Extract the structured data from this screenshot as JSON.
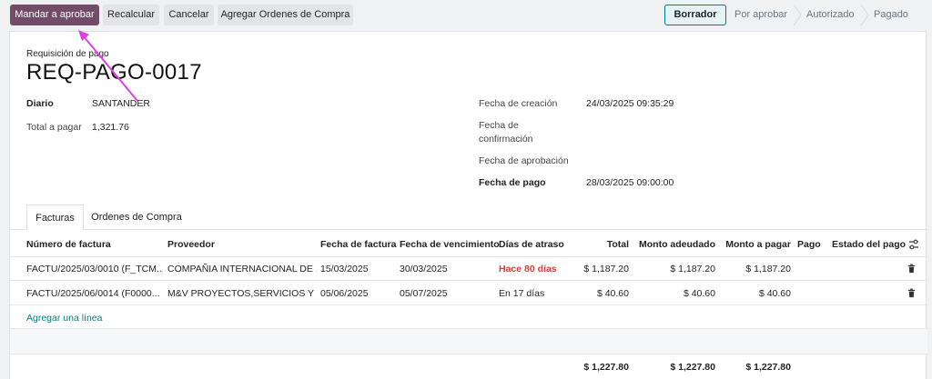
{
  "toolbar": {
    "send_label": "Mandar a aprobar",
    "recalc_label": "Recalcular",
    "cancel_label": "Cancelar",
    "add_po_label": "Agregar Ordenes de Compra"
  },
  "status": {
    "stages": [
      "Borrador",
      "Por aprobar",
      "Autorizado",
      "Pagado"
    ],
    "active": "Borrador"
  },
  "form": {
    "subtitle": "Requisición de pago",
    "title": "REQ-PAGO-0017",
    "diario_label": "Diario",
    "diario_value": "SANTANDER",
    "total_label": "Total a pagar",
    "total_value": "1,321.76",
    "creation_label": "Fecha de creación",
    "creation_value": "24/03/2025 09:35:29",
    "confirm_label_1": "Fecha de",
    "confirm_label_2": "confirmación",
    "approval_label": "Fecha de aprobación",
    "payment_label": "Fecha de pago",
    "payment_value": "28/03/2025 09:00:00"
  },
  "tabs": [
    "Facturas",
    "Ordenes de Compra"
  ],
  "table": {
    "headers": {
      "invoice": "Número de factura",
      "vendor": "Proveedor",
      "invoice_date": "Fecha de factura",
      "due_date": "Fecha de vencimiento",
      "overdue": "Días de atraso",
      "total": "Total",
      "due_amount": "Monto adeudado",
      "pay_amount": "Monto a pagar",
      "pago": "Pago",
      "pay_state": "Estado del pago"
    },
    "rows": [
      {
        "invoice": "FACTU/2025/03/0010 (F_TCM...",
        "vendor": "COMPAÑIA INTERNACIONAL DE ...",
        "invoice_date": "15/03/2025",
        "due_date": "30/03/2025",
        "overdue": "Hace 80 días",
        "total": "$ 1,187.20",
        "due_amount": "$ 1,187.20",
        "pay_amount": "$ 1,187.20"
      },
      {
        "invoice": "FACTU/2025/06/0014 (F0000...",
        "vendor": "M&V PROYECTOS,SERVICIOS Y L...",
        "invoice_date": "05/06/2025",
        "due_date": "05/07/2025",
        "overdue": "En 17 días",
        "total": "$ 40.60",
        "due_amount": "$ 40.60",
        "pay_amount": "$ 40.60"
      }
    ],
    "add_line": "Agregar una línea",
    "totals": {
      "total": "$ 1,227.80",
      "due_amount": "$ 1,227.80",
      "pay_amount": "$ 1,227.80"
    }
  },
  "colors": {
    "primary": "#714b67",
    "accent": "#017e84",
    "late": "#d23f3a",
    "annotation_arrow": "#e040e0"
  },
  "icons": [
    "trash-icon",
    "column-settings-icon"
  ]
}
